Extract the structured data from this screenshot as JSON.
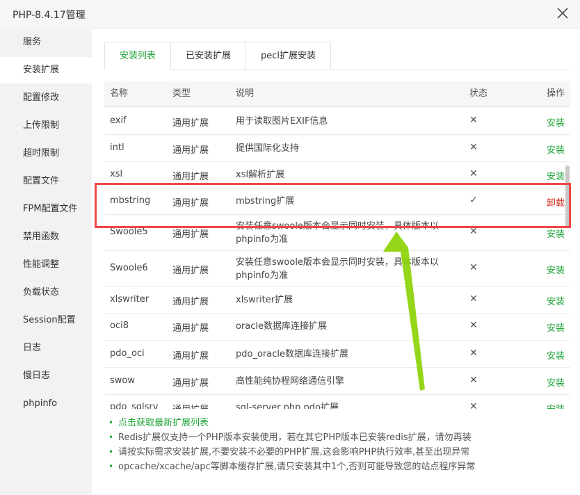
{
  "window": {
    "title": "PHP-8.4.17管理"
  },
  "sidebar": {
    "items": [
      {
        "label": "服务"
      },
      {
        "label": "安装扩展",
        "active": true
      },
      {
        "label": "配置修改"
      },
      {
        "label": "上传限制"
      },
      {
        "label": "超时限制"
      },
      {
        "label": "配置文件"
      },
      {
        "label": "FPM配置文件"
      },
      {
        "label": "禁用函数"
      },
      {
        "label": "性能调整"
      },
      {
        "label": "负载状态"
      },
      {
        "label": "Session配置"
      },
      {
        "label": "日志"
      },
      {
        "label": "慢日志"
      },
      {
        "label": "phpinfo"
      }
    ]
  },
  "tabs": [
    {
      "label": "安装列表",
      "active": true
    },
    {
      "label": "已安装扩展"
    },
    {
      "label": "pecl扩展安装"
    }
  ],
  "table": {
    "headers": {
      "name": "名称",
      "type": "类型",
      "desc": "说明",
      "status": "状态",
      "op": "操作"
    },
    "rows": [
      {
        "name": "exif",
        "type": "通用扩展",
        "desc": "用于读取图片EXIF信息",
        "status": "✕",
        "op": "安装"
      },
      {
        "name": "intl",
        "type": "通用扩展",
        "desc": "提供国际化支持",
        "status": "✕",
        "op": "安装"
      },
      {
        "name": "xsl",
        "type": "通用扩展",
        "desc": "xsl解析扩展",
        "status": "✕",
        "op": "安装"
      },
      {
        "name": "mbstring",
        "type": "通用扩展",
        "desc": "mbstring扩展",
        "status": "✓",
        "op": "卸载"
      },
      {
        "name": "Swoole5",
        "type": "通用扩展",
        "desc": "安装任意swoole版本会显示同时安装，具体版本以phpinfo为准",
        "status": "✕",
        "op": "安装"
      },
      {
        "name": "Swoole6",
        "type": "通用扩展",
        "desc": "安装任意swoole版本会显示同时安装，具体版本以phpinfo为准",
        "status": "✕",
        "op": "安装"
      },
      {
        "name": "xlswriter",
        "type": "通用扩展",
        "desc": "xlswriter扩展",
        "status": "✕",
        "op": "安装"
      },
      {
        "name": "oci8",
        "type": "通用扩展",
        "desc": "oracle数据库连接扩展",
        "status": "✕",
        "op": "安装"
      },
      {
        "name": "pdo_oci",
        "type": "通用扩展",
        "desc": "pdo_oracle数据库连接扩展",
        "status": "✕",
        "op": "安装"
      },
      {
        "name": "swow",
        "type": "通用扩展",
        "desc": "高性能纯协程网络通信引擎",
        "status": "✕",
        "op": "安装"
      },
      {
        "name": "pdo_sqlsrv",
        "type": "通用扩展",
        "desc": "sql-server php pdo扩展",
        "status": "✕",
        "op": "安装"
      }
    ]
  },
  "notes": [
    "点击获取最新扩展列表",
    "Redis扩展仅支持一个PHP版本安装使用，若在其它PHP版本已安装redis扩展，请勿再装",
    "请按实际需求安装扩展,不要安装不必要的PHP扩展,这会影响PHP执行效率,甚至出现异常",
    "opcache/xcache/apc等脚本缓存扩展,请只安装其中1个,否则可能导致您的站点程序异常"
  ],
  "colors": {
    "accent": "#20a53a",
    "danger": "#d93025",
    "highlight_box": "#ee4747",
    "arrow": "#8fd40e"
  },
  "icons": {
    "close": "close-icon",
    "status_no": "cross-icon",
    "status_yes": "check-icon"
  }
}
